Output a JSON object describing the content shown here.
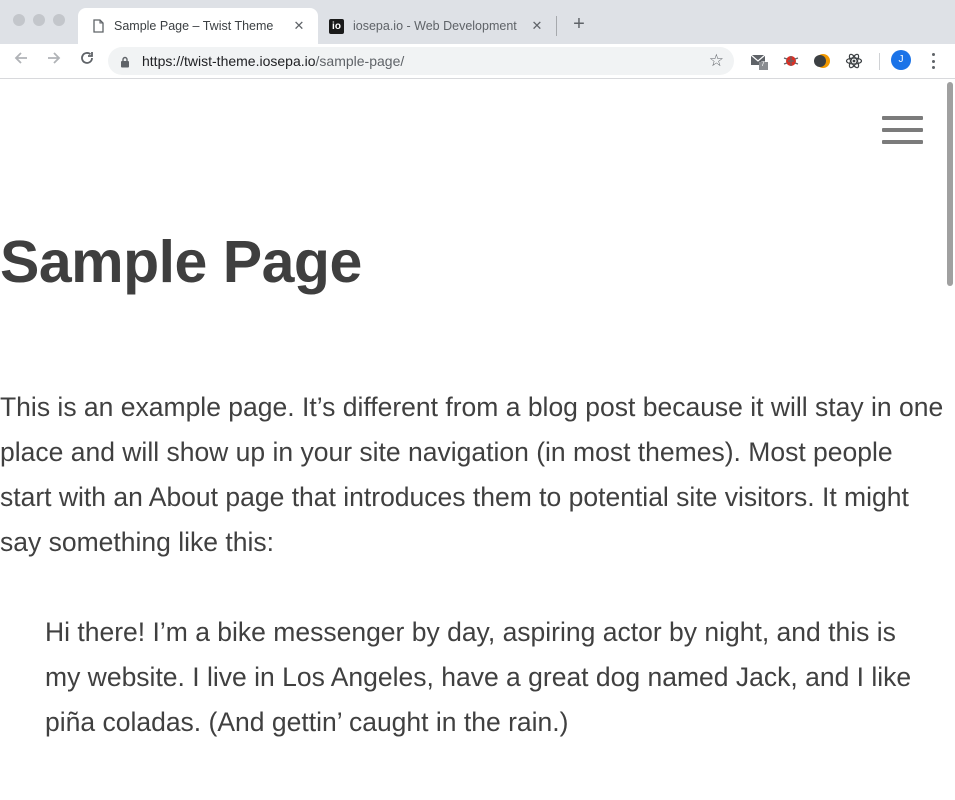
{
  "browser": {
    "tabs": [
      {
        "title": "Sample Page – Twist Theme",
        "active": true,
        "favicon": "page-icon"
      },
      {
        "title": "iosepa.io - Web Development",
        "active": false,
        "favicon": "io-favicon",
        "favicon_text": "io"
      }
    ],
    "tab_close_glyph": "✕",
    "new_tab_glyph": "+",
    "url": {
      "host": "https://twist-theme.iosepa.io",
      "path": "/sample-page/"
    },
    "mail_badge": "7",
    "avatar_initial": "J",
    "icons": [
      "back-arrow-icon",
      "forward-arrow-icon",
      "reload-icon",
      "lock-icon",
      "star-icon",
      "mail-extension-icon",
      "bug-extension-icon",
      "moon-extension-icon",
      "react-extension-icon",
      "kebab-menu-icon"
    ],
    "accent_color": "#1a73e8"
  },
  "page": {
    "title": "Sample Page",
    "intro": "This is an example page. It’s different from a blog post because it will stay in one place and will show up in your site navigation (in most themes). Most people start with an About page that introduces them to potential site visitors. It might say something like this:",
    "quote": "Hi there! I’m a bike messenger by day, aspiring actor by night, and this is my website. I live in Los Angeles, have a great dog named Jack, and I like piña coladas. (And gettin’ caught in the rain.)",
    "text_color": "#404040",
    "nav_icon": "hamburger-menu-icon"
  }
}
